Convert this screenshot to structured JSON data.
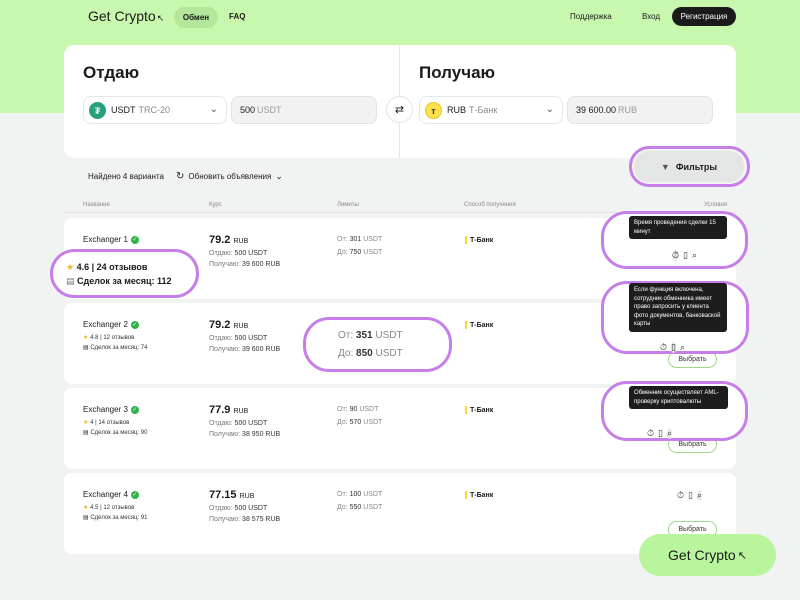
{
  "nav": {
    "logo": "Get Crypto",
    "exchange": "Обмен",
    "faq": "FAQ",
    "support": "Поддержка",
    "login": "Вход",
    "register": "Регистрация"
  },
  "exchange": {
    "give_title": "Отдаю",
    "get_title": "Получаю",
    "give_currency": "USDT",
    "give_network": "TRC-20",
    "give_amount": "500",
    "give_unit": "USDT",
    "get_currency": "RUB",
    "get_network": "Т-Банк",
    "get_amount": "39 600.00",
    "get_unit": "RUB"
  },
  "results": {
    "found": "Найдено 4 варианта",
    "refresh": "Обновить объявления",
    "filters": "Фильтры"
  },
  "columns": {
    "name": "Название",
    "rate": "Курс",
    "limits": "Лимиты",
    "method": "Способ получения",
    "conditions": "Условия"
  },
  "labels": {
    "give": "Отдаю:",
    "get": "Получаю:",
    "from": "От:",
    "to": "До:",
    "choose": "Выбрать"
  },
  "rows": [
    {
      "name": "Exchanger 1",
      "rating": "4.6",
      "reviews": "24 отзывов",
      "deals": "Сделок за месяц: 112",
      "rate": "79.2",
      "rate_cur": "RUB",
      "give": "500 USDT",
      "get": "39 600 RUB",
      "min": "301",
      "max": "750",
      "lim_unit": "USDT",
      "method": "Т-Банк"
    },
    {
      "name": "Exchanger 2",
      "rating": "4.8",
      "reviews": "12 отзывов",
      "deals": "Сделок за месяц: 74",
      "rate": "79.2",
      "rate_cur": "RUB",
      "give": "500 USDT",
      "get": "39 600 RUB",
      "min": "351",
      "max": "850",
      "lim_unit": "USDT",
      "method": "Т-Банк"
    },
    {
      "name": "Exchanger 3",
      "rating": "4",
      "reviews": "14 отзывов",
      "deals": "Сделок за месяц: 90",
      "rate": "77.9",
      "rate_cur": "RUB",
      "give": "500 USDT",
      "get": "38 950 RUB",
      "min": "90",
      "max": "570",
      "lim_unit": "USDT",
      "method": "Т-Банк"
    },
    {
      "name": "Exchanger 4",
      "rating": "4.5",
      "reviews": "12 отзывов",
      "deals": "Сделок за месяц: 91",
      "rate": "77.15",
      "rate_cur": "RUB",
      "give": "500 USDT",
      "get": "38 575 RUB",
      "min": "100",
      "max": "550",
      "lim_unit": "USDT",
      "method": "Т-Банк"
    }
  ],
  "tooltips": {
    "time": "Время проведения сделки 15 минут",
    "documents": "Если функция включена, сотрудник обменника имеет право запросить у клиента фото документов, банковаской карты",
    "aml": "Обменник осуществляет AML-проверку криптовалюты"
  },
  "cta": "Get Crypto",
  "icons": [
    "stopwatch-icon",
    "document-icon",
    "search-icon",
    "refresh-icon",
    "chevron-down-icon",
    "filter-icon",
    "swap-icon",
    "star-icon",
    "deals-icon",
    "verified-icon",
    "cursor-icon"
  ],
  "colors": {
    "accent_green": "#c8f7ae",
    "highlight": "#c67ee8",
    "dark": "#1a1a1a"
  }
}
